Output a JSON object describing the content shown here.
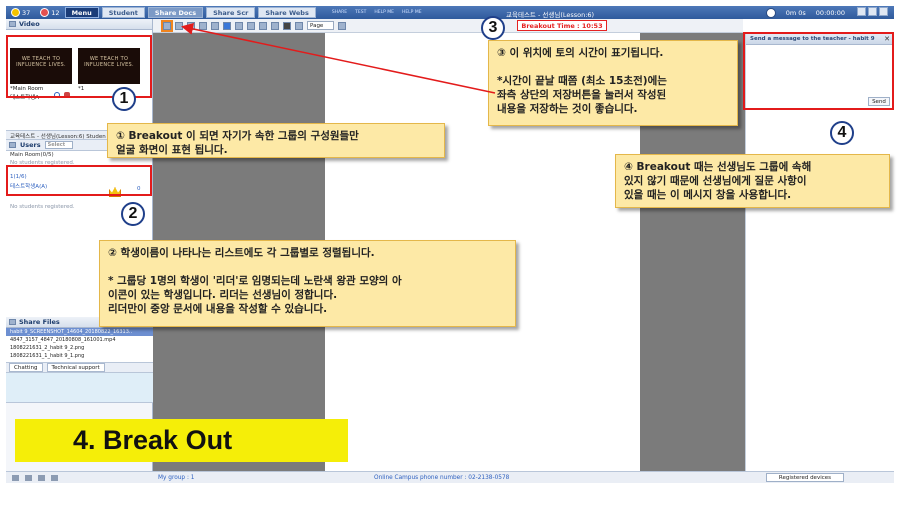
{
  "topbar": {
    "counter_a": "37",
    "counter_b": "12",
    "menu_label": "Menu",
    "tabs": [
      "Student",
      "Share Docs",
      "Share Scr",
      "Share Webs"
    ],
    "small_labels": [
      "SHARE",
      "TEST",
      "HELP ME",
      "HELP ME"
    ],
    "title": "교육테스트 - 선생님(Lesson:6)",
    "timer_label": "0m 0s",
    "clock_value": "00:00:00"
  },
  "left": {
    "video_title": "Video",
    "thumb_text": "WE TEACH TO INFLUENCE LIVES.",
    "main_room_label": "*Main Room",
    "main_room_num": "*1",
    "student_name": "테스트학생A",
    "room_title": "교육테스트 - 선생님(Lesson:6) Studen",
    "users_label": "Users",
    "select_label": "Select",
    "main_room_count": "Main Room(0/5)",
    "no_students_1": "No students registered.",
    "group_label": "1(1/6)",
    "group_student": "테스트학생A(A)",
    "group_count": "0",
    "no_students_2": "No students registered.",
    "my_group": "My group : 1",
    "share_files_label": "Share Files",
    "files": [
      "habit 9_SCREENSHOT_14604_20180822_16313..",
      "4847_3157_4847_20180808_161001.mp4",
      "1808221631_2_habit 9_2.png",
      "1808221631_1_habit 9_1.png"
    ],
    "chatting_label": "Chatting",
    "tech_support_label": "Technical support"
  },
  "toolbar": {
    "page_select": "Page"
  },
  "breakout_time": "Breakout Time : 10:53",
  "right": {
    "message_header": "Send a message to the teacher - habit 9",
    "send_label": "Send"
  },
  "bottombar": {
    "my_group": "My group : 1",
    "phone": "Online Campus phone number : 02-2138-0578",
    "registered_devices": "Registered devices"
  },
  "annotations": {
    "num1": "1",
    "num2": "2",
    "num3": "3",
    "num4": "4",
    "callout1": "① Breakout 이 되면 자기가 속한 그룹의 구성원들만\n 얼굴 화면이 표현 됩니다.",
    "callout2": "② 학생이름이 나타나는 리스트에도 각 그룹별로 정렬됩니다.\n\n* 그룹당 1명의 학생이 '리더'로 임명되는데 노란색 왕관 모양의  아\n이콘이 있는 학생입니다. 리더는 선생님이 정합니다.\n리더만이 중앙 문서에 내용을 작성할 수 있습니다.",
    "callout3": "③ 이 위치에 토의 시간이 표기됩니다.\n\n*시간이 끝날 때쯤 (최소 15초전)에는\n좌측 상단의 저장버튼을 눌러서 작성된\n내용을 저장하는 것이 좋습니다.",
    "callout4": "④ Breakout 때는 선생님도 그룹에 속해\n 있지 않기 때문에 선생님에게 질문 사항이\n 있을 때는 이 메시지 창을 사용합니다.",
    "big_label": "4. Break Out"
  }
}
